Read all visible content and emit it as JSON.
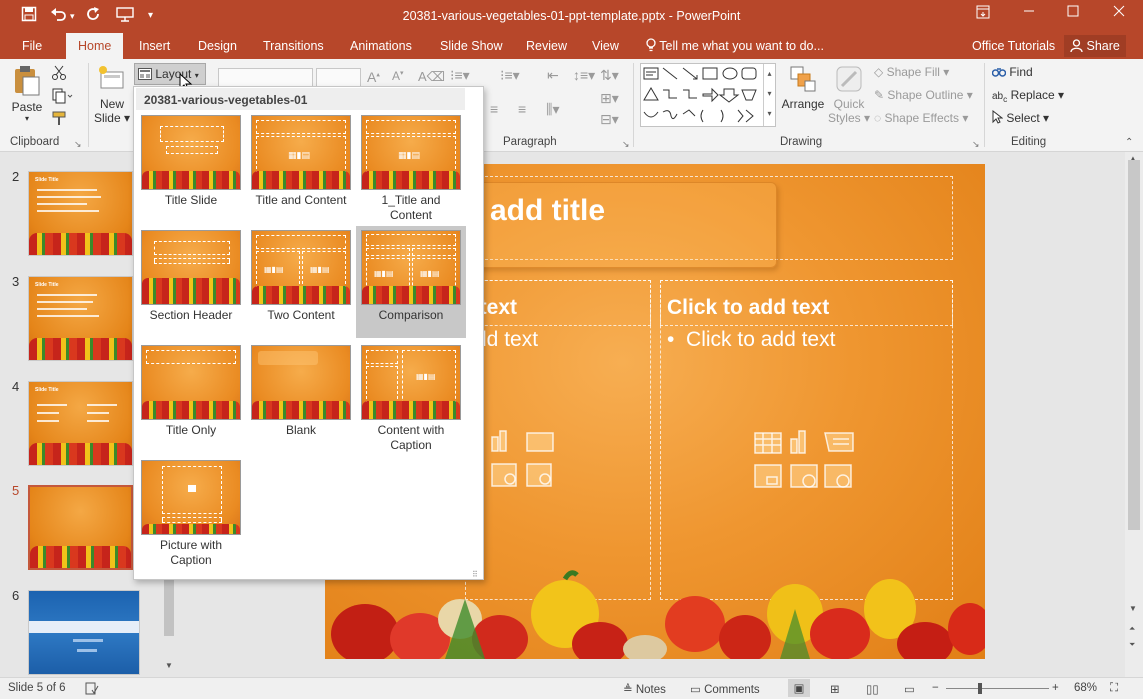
{
  "window": {
    "title": "20381-various-vegetables-01-ppt-template.pptx - PowerPoint",
    "quick_access": [
      "save-icon",
      "undo-icon",
      "redo-icon",
      "present-icon",
      "customize-icon"
    ],
    "controls": [
      "ribbon-display-icon",
      "minimize-icon",
      "restore-icon",
      "close-icon"
    ]
  },
  "tabs": {
    "file": "File",
    "home": "Home",
    "insert": "Insert",
    "design": "Design",
    "transitions": "Transitions",
    "animations": "Animations",
    "slide_show": "Slide Show",
    "review": "Review",
    "view": "View",
    "tell_me": "Tell me what you want to do...",
    "account": "Office Tutorials",
    "share": "Share"
  },
  "ribbon": {
    "clipboard": {
      "label": "Clipboard",
      "paste": "Paste"
    },
    "slides": {
      "new_slide": "New",
      "new_slide_2": "Slide",
      "layout": "Layout"
    },
    "paragraph": {
      "label": "Paragraph"
    },
    "drawing": {
      "label": "Drawing",
      "arrange": "Arrange",
      "quick_styles": "Quick",
      "quick_styles_2": "Styles",
      "shape_fill": "Shape Fill",
      "shape_outline": "Shape Outline",
      "shape_effects": "Shape Effects"
    },
    "editing": {
      "label": "Editing",
      "find": "Find",
      "replace": "Replace",
      "select": "Select"
    }
  },
  "layout_menu": {
    "header": "20381-various-vegetables-01",
    "selected": "Comparison",
    "items": [
      {
        "name": "Title Slide"
      },
      {
        "name": "Title and Content"
      },
      {
        "name": "1_Title and",
        "name2": "Content"
      },
      {
        "name": "Section Header"
      },
      {
        "name": "Two Content"
      },
      {
        "name": "Comparison"
      },
      {
        "name": "Title Only"
      },
      {
        "name": "Blank"
      },
      {
        "name": "Content with",
        "name2": "Caption"
      },
      {
        "name": "Picture with",
        "name2": "Caption"
      }
    ]
  },
  "thumbnails": {
    "numbers": [
      "2",
      "3",
      "4",
      "5",
      "6"
    ],
    "current": "5",
    "slide2_title": "Slide Title",
    "slide3_title": "Slide Title",
    "slide4_title": "Slide Title"
  },
  "slide": {
    "title": "add title",
    "left_header": "l text",
    "left_body": "dd text",
    "right_header": "Click to add text",
    "right_body": "Click to add text"
  },
  "status": {
    "slide_of": "Slide 5 of 6",
    "notes": "Notes",
    "comments": "Comments",
    "zoom": "68%"
  },
  "colors": {
    "accent": "#b7472a",
    "slide_orange": "#ef9630"
  }
}
